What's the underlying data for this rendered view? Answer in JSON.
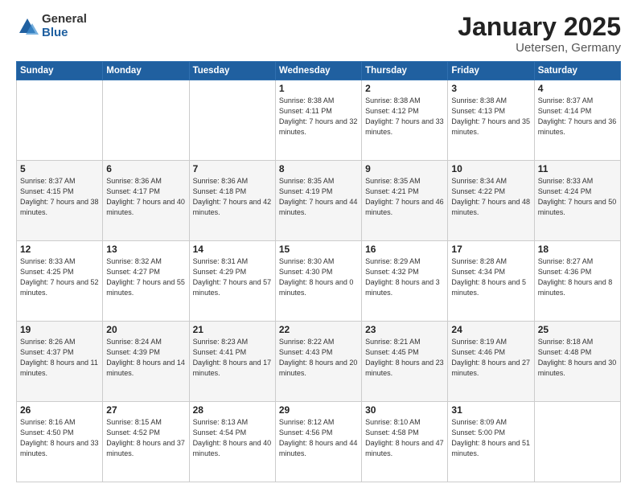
{
  "logo": {
    "general": "General",
    "blue": "Blue"
  },
  "title": {
    "month": "January 2025",
    "location": "Uetersen, Germany"
  },
  "weekdays": [
    "Sunday",
    "Monday",
    "Tuesday",
    "Wednesday",
    "Thursday",
    "Friday",
    "Saturday"
  ],
  "weeks": [
    [
      {
        "day": "",
        "info": ""
      },
      {
        "day": "",
        "info": ""
      },
      {
        "day": "",
        "info": ""
      },
      {
        "day": "1",
        "info": "Sunrise: 8:38 AM\nSunset: 4:11 PM\nDaylight: 7 hours\nand 32 minutes."
      },
      {
        "day": "2",
        "info": "Sunrise: 8:38 AM\nSunset: 4:12 PM\nDaylight: 7 hours\nand 33 minutes."
      },
      {
        "day": "3",
        "info": "Sunrise: 8:38 AM\nSunset: 4:13 PM\nDaylight: 7 hours\nand 35 minutes."
      },
      {
        "day": "4",
        "info": "Sunrise: 8:37 AM\nSunset: 4:14 PM\nDaylight: 7 hours\nand 36 minutes."
      }
    ],
    [
      {
        "day": "5",
        "info": "Sunrise: 8:37 AM\nSunset: 4:15 PM\nDaylight: 7 hours\nand 38 minutes."
      },
      {
        "day": "6",
        "info": "Sunrise: 8:36 AM\nSunset: 4:17 PM\nDaylight: 7 hours\nand 40 minutes."
      },
      {
        "day": "7",
        "info": "Sunrise: 8:36 AM\nSunset: 4:18 PM\nDaylight: 7 hours\nand 42 minutes."
      },
      {
        "day": "8",
        "info": "Sunrise: 8:35 AM\nSunset: 4:19 PM\nDaylight: 7 hours\nand 44 minutes."
      },
      {
        "day": "9",
        "info": "Sunrise: 8:35 AM\nSunset: 4:21 PM\nDaylight: 7 hours\nand 46 minutes."
      },
      {
        "day": "10",
        "info": "Sunrise: 8:34 AM\nSunset: 4:22 PM\nDaylight: 7 hours\nand 48 minutes."
      },
      {
        "day": "11",
        "info": "Sunrise: 8:33 AM\nSunset: 4:24 PM\nDaylight: 7 hours\nand 50 minutes."
      }
    ],
    [
      {
        "day": "12",
        "info": "Sunrise: 8:33 AM\nSunset: 4:25 PM\nDaylight: 7 hours\nand 52 minutes."
      },
      {
        "day": "13",
        "info": "Sunrise: 8:32 AM\nSunset: 4:27 PM\nDaylight: 7 hours\nand 55 minutes."
      },
      {
        "day": "14",
        "info": "Sunrise: 8:31 AM\nSunset: 4:29 PM\nDaylight: 7 hours\nand 57 minutes."
      },
      {
        "day": "15",
        "info": "Sunrise: 8:30 AM\nSunset: 4:30 PM\nDaylight: 8 hours\nand 0 minutes."
      },
      {
        "day": "16",
        "info": "Sunrise: 8:29 AM\nSunset: 4:32 PM\nDaylight: 8 hours\nand 3 minutes."
      },
      {
        "day": "17",
        "info": "Sunrise: 8:28 AM\nSunset: 4:34 PM\nDaylight: 8 hours\nand 5 minutes."
      },
      {
        "day": "18",
        "info": "Sunrise: 8:27 AM\nSunset: 4:36 PM\nDaylight: 8 hours\nand 8 minutes."
      }
    ],
    [
      {
        "day": "19",
        "info": "Sunrise: 8:26 AM\nSunset: 4:37 PM\nDaylight: 8 hours\nand 11 minutes."
      },
      {
        "day": "20",
        "info": "Sunrise: 8:24 AM\nSunset: 4:39 PM\nDaylight: 8 hours\nand 14 minutes."
      },
      {
        "day": "21",
        "info": "Sunrise: 8:23 AM\nSunset: 4:41 PM\nDaylight: 8 hours\nand 17 minutes."
      },
      {
        "day": "22",
        "info": "Sunrise: 8:22 AM\nSunset: 4:43 PM\nDaylight: 8 hours\nand 20 minutes."
      },
      {
        "day": "23",
        "info": "Sunrise: 8:21 AM\nSunset: 4:45 PM\nDaylight: 8 hours\nand 23 minutes."
      },
      {
        "day": "24",
        "info": "Sunrise: 8:19 AM\nSunset: 4:46 PM\nDaylight: 8 hours\nand 27 minutes."
      },
      {
        "day": "25",
        "info": "Sunrise: 8:18 AM\nSunset: 4:48 PM\nDaylight: 8 hours\nand 30 minutes."
      }
    ],
    [
      {
        "day": "26",
        "info": "Sunrise: 8:16 AM\nSunset: 4:50 PM\nDaylight: 8 hours\nand 33 minutes."
      },
      {
        "day": "27",
        "info": "Sunrise: 8:15 AM\nSunset: 4:52 PM\nDaylight: 8 hours\nand 37 minutes."
      },
      {
        "day": "28",
        "info": "Sunrise: 8:13 AM\nSunset: 4:54 PM\nDaylight: 8 hours\nand 40 minutes."
      },
      {
        "day": "29",
        "info": "Sunrise: 8:12 AM\nSunset: 4:56 PM\nDaylight: 8 hours\nand 44 minutes."
      },
      {
        "day": "30",
        "info": "Sunrise: 8:10 AM\nSunset: 4:58 PM\nDaylight: 8 hours\nand 47 minutes."
      },
      {
        "day": "31",
        "info": "Sunrise: 8:09 AM\nSunset: 5:00 PM\nDaylight: 8 hours\nand 51 minutes."
      },
      {
        "day": "",
        "info": ""
      }
    ]
  ]
}
